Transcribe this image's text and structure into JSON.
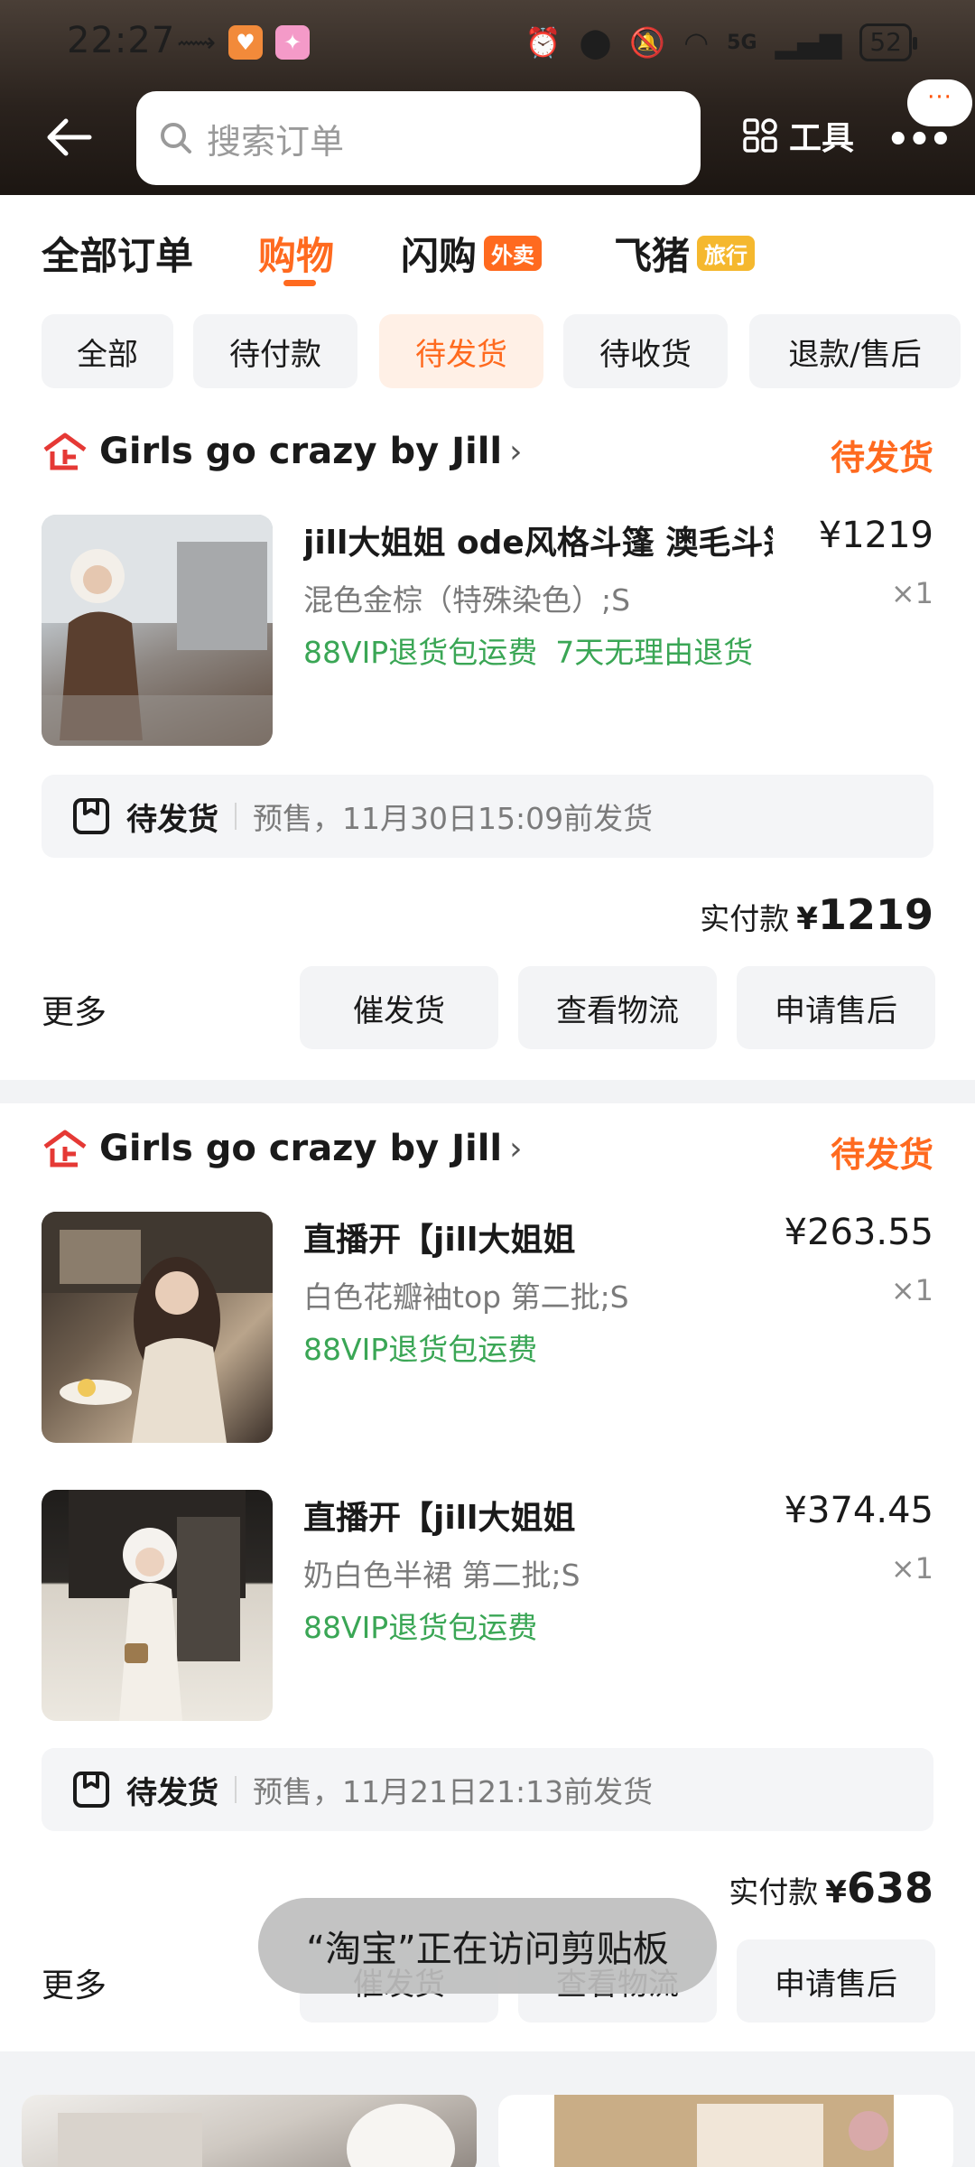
{
  "status_bar": {
    "time": "22:27",
    "battery": "52",
    "network": "5G"
  },
  "header": {
    "search_placeholder": "搜索订单",
    "tools_label": "工具",
    "more_label": "•••",
    "mini_bubble": "···"
  },
  "tabs": [
    {
      "label": "全部订单"
    },
    {
      "label": "购物",
      "active": true
    },
    {
      "label": "闪购",
      "badge": "外卖"
    },
    {
      "label": "飞猪",
      "badge": "旅行"
    }
  ],
  "filters": [
    {
      "label": "全部"
    },
    {
      "label": "待付款"
    },
    {
      "label": "待发货",
      "active": true
    },
    {
      "label": "待收货"
    },
    {
      "label": "退款/售后"
    }
  ],
  "orders": [
    {
      "shop_name": "Girls go crazy by Jill",
      "status": "待发货",
      "items": [
        {
          "title": "jill大姐姐 ode风格斗篷 澳毛斗篷",
          "price": "¥1219",
          "sku": "混色金棕（特殊染色）;S",
          "qty": "×1",
          "tags": [
            "88VIP退货包运费",
            "7天无理由退货"
          ]
        }
      ],
      "ship_status": "待发货",
      "ship_detail": "预售，11月30日15:09前发货",
      "paid_label": "实付款",
      "paid_currency": "¥",
      "paid_amount": "1219",
      "more_label": "更多",
      "actions": [
        "催发货",
        "查看物流",
        "申请售后"
      ]
    },
    {
      "shop_name": "Girls go crazy by Jill",
      "status": "待发货",
      "items": [
        {
          "title": "直播开【jill大姐姐",
          "price": "¥263.55",
          "sku": "白色花瓣袖top 第二批;S",
          "qty": "×1",
          "tags": [
            "88VIP退货包运费"
          ]
        },
        {
          "title": "直播开【jill大姐姐",
          "price": "¥374.45",
          "sku": "奶白色半裙 第二批;S",
          "qty": "×1",
          "tags": [
            "88VIP退货包运费"
          ]
        }
      ],
      "ship_status": "待发货",
      "ship_detail": "预售，11月21日21:13前发货",
      "paid_label": "实付款",
      "paid_currency": "¥",
      "paid_amount": "638",
      "more_label": "更多",
      "actions": [
        "催发货",
        "查看物流",
        "申请售后"
      ]
    }
  ],
  "toast": "“淘宝”正在访问剪贴板",
  "colors": {
    "accent": "#ff6a1f",
    "tag_green": "#3aa655",
    "badge_flash": "#ff6a1f",
    "badge_travel": "#f5b82e"
  }
}
